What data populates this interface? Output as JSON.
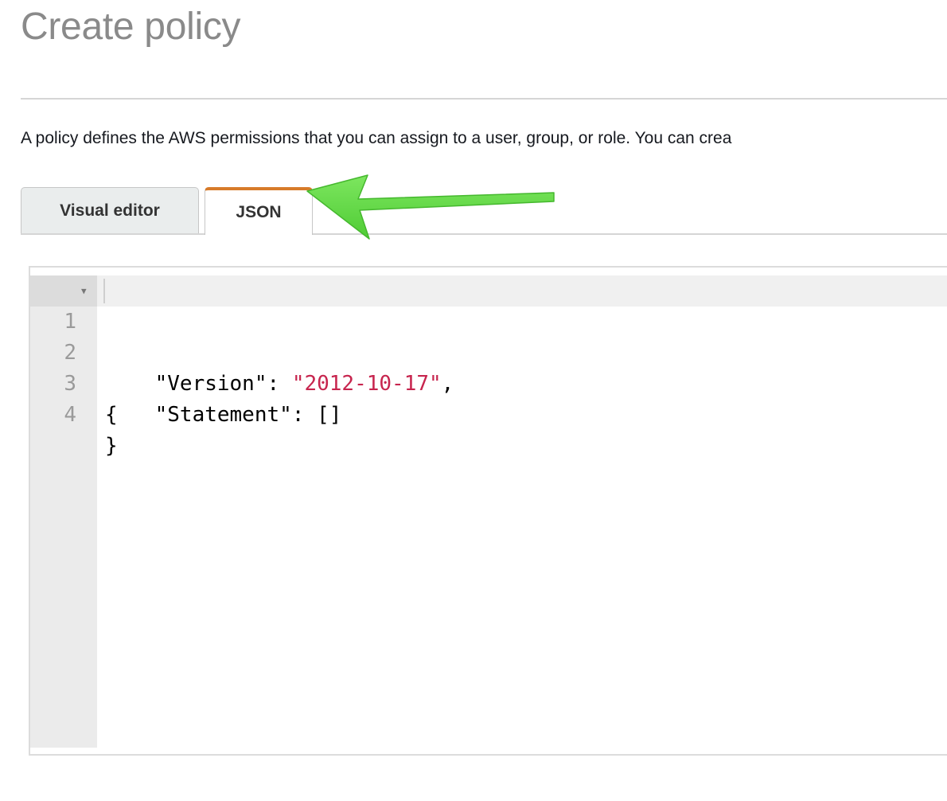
{
  "page": {
    "title": "Create policy",
    "description": "A policy defines the AWS permissions that you can assign to a user, group, or role. You can crea"
  },
  "tabs": [
    {
      "label": "Visual editor",
      "active": false
    },
    {
      "label": "JSON",
      "active": true
    }
  ],
  "annotation": {
    "icon": "arrow-left-icon",
    "color": "#62d84a"
  },
  "colors": {
    "active_tab_accent": "#d77b2a",
    "string_literal": "#c7254e"
  },
  "editor": {
    "lines": [
      {
        "number": "1",
        "has_fold": true,
        "parts": [
          "{"
        ]
      },
      {
        "number": "2",
        "has_fold": false,
        "parts": [
          "    \"Version\": ",
          "\"2012-10-17\"",
          ","
        ]
      },
      {
        "number": "3",
        "has_fold": false,
        "parts": [
          "    \"Statement\": []"
        ]
      },
      {
        "number": "4",
        "has_fold": false,
        "parts": [
          "}"
        ]
      }
    ]
  }
}
